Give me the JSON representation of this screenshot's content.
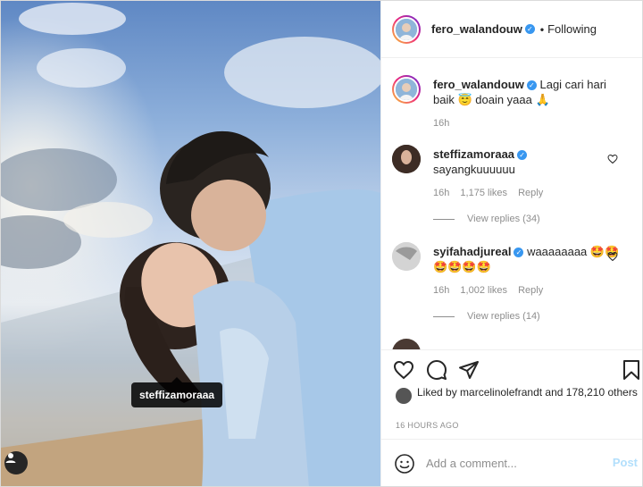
{
  "photo": {
    "tagged_user": "steffizamoraaa",
    "user_tag_icon": "user-icon"
  },
  "header": {
    "username": "fero_walandouw",
    "separator": "•",
    "follow_status": "Following"
  },
  "caption": {
    "username": "fero_walandouw",
    "text": "Lagi cari hari baik 😇 doain yaaa 🙏",
    "time": "16h"
  },
  "comments": [
    {
      "username": "steffizamoraaa",
      "text": "sayangkuuuuuu",
      "time": "16h",
      "likes": "1,175 likes",
      "reply_label": "Reply",
      "view_replies": "View replies (34)"
    },
    {
      "username": "syifahadjureal",
      "text": "waaaaaaaa 🤩🤩🤩🤩🤩🤩",
      "time": "16h",
      "likes": "1,002 likes",
      "reply_label": "Reply",
      "view_replies": "View replies (14)"
    }
  ],
  "actions": {
    "likes_text": "Liked by marcelinolefrandt and 178,210 others",
    "time_ago": "16 HOURS AGO"
  },
  "add_comment": {
    "placeholder": "Add a comment...",
    "post_label": "Post"
  },
  "colors": {
    "verified": "#3897f0",
    "post_disabled": "#b2dffc",
    "muted": "#8e8e8e"
  }
}
